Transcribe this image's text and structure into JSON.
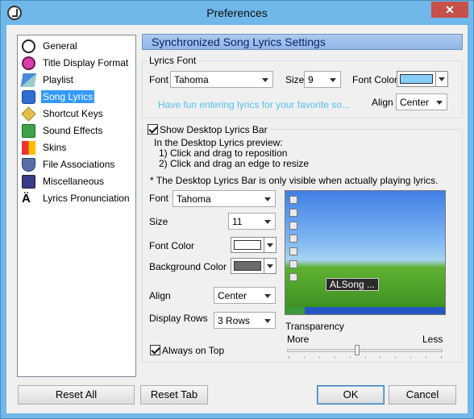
{
  "window": {
    "title": "Preferences",
    "close_glyph": "✕"
  },
  "nav": {
    "items": [
      {
        "label": "General",
        "icon": "general-icon"
      },
      {
        "label": "Title Display Format",
        "icon": "title-format-icon"
      },
      {
        "label": "Playlist",
        "icon": "playlist-icon"
      },
      {
        "label": "Song Lyrics",
        "icon": "song-lyrics-icon",
        "selected": true
      },
      {
        "label": "Shortcut Keys",
        "icon": "shortcut-keys-icon"
      },
      {
        "label": "Sound Effects",
        "icon": "sound-effects-icon"
      },
      {
        "label": "Skins",
        "icon": "skins-icon"
      },
      {
        "label": "File Associations",
        "icon": "file-associations-icon"
      },
      {
        "label": "Miscellaneous",
        "icon": "miscellaneous-icon"
      },
      {
        "label": "Lyrics Pronunciation",
        "icon": "lyrics-pronunciation-icon"
      }
    ]
  },
  "header": {
    "title": "Synchronized Song Lyrics Settings"
  },
  "lyrics_font": {
    "group_label": "Lyrics Font",
    "font_label": "Font",
    "font_value": "Tahoma",
    "size_label": "Size",
    "size_value": "9",
    "font_color_label": "Font Color",
    "font_color": "#87cefa",
    "preview_text": "Have fun entering lyrics for your favorite so...",
    "align_label": "Align",
    "align_value": "Center"
  },
  "desktop_bar": {
    "checkbox_label": "Show Desktop Lyrics Bar",
    "checked": true,
    "instructions": [
      "In the Desktop Lyrics preview:",
      "1) Click and drag to reposition",
      "2) Click and drag an edge to resize"
    ],
    "note": "* The Desktop Lyrics Bar is only visible when actually playing lyrics.",
    "font_label": "Font",
    "font_value": "Tahoma",
    "size_label": "Size",
    "size_value": "11",
    "font_color_label": "Font Color",
    "font_color": "#ffffff",
    "bg_color_label": "Background Color",
    "bg_color": "#6b6b6b",
    "align_label": "Align",
    "align_value": "Center",
    "rows_label": "Display Rows",
    "rows_value": "3 Rows",
    "always_on_top_label": "Always on Top",
    "always_on_top": true,
    "preview_bar_text": "ALSong ...",
    "transparency_label": "Transparency",
    "transparency_more": "More",
    "transparency_less": "Less",
    "transparency_level": 0.45
  },
  "buttons": {
    "reset_all": "Reset All",
    "reset_tab": "Reset Tab",
    "ok": "OK",
    "cancel": "Cancel"
  }
}
